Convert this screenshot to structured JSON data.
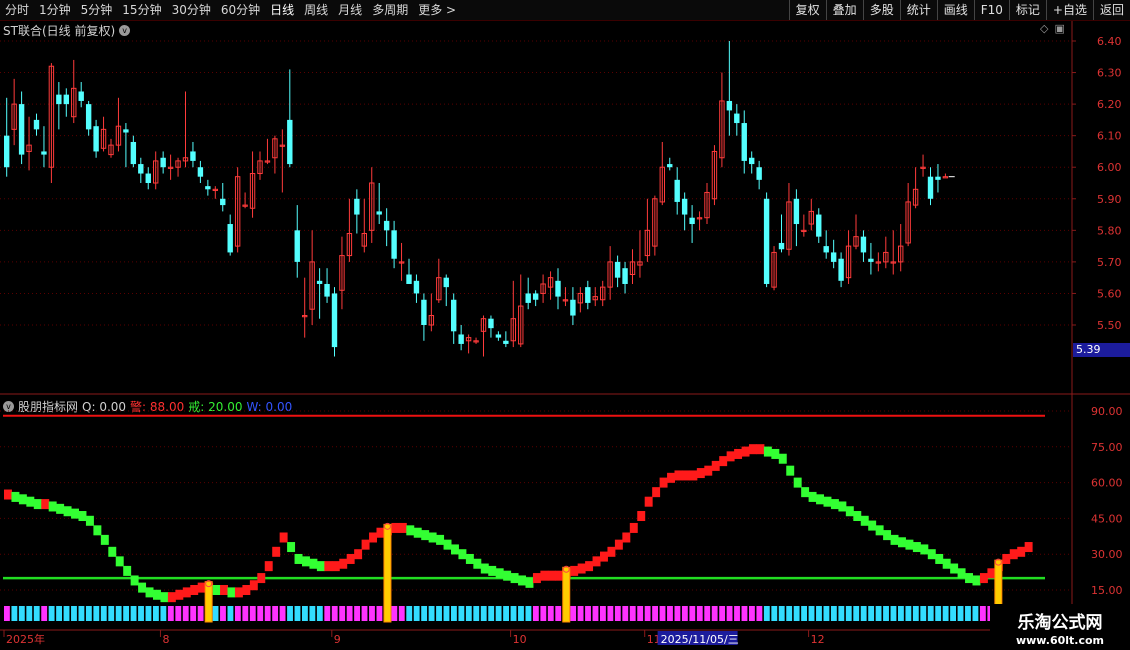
{
  "toolbar": {
    "periods": [
      "分时",
      "1分钟",
      "5分钟",
      "15分钟",
      "30分钟",
      "60分钟",
      "日线",
      "周线",
      "月线",
      "多周期",
      "更多 >"
    ],
    "active": "日线",
    "right_buttons": [
      "复权",
      "叠加",
      "多股",
      "统计",
      "画线",
      "F10",
      "标记",
      "+自选",
      "返回"
    ]
  },
  "title": "ST联合(日线 前复权)",
  "indicator": {
    "name": "股朋指标网",
    "q_label": "Q: 0.00",
    "warn_label": "警: 88.00",
    "jie_label": "戒: 20.00",
    "w_label": "W: 0.00"
  },
  "price_axis": [
    "6.40",
    "6.30",
    "6.20",
    "6.10",
    "6.00",
    "5.90",
    "5.80",
    "5.70",
    "5.60",
    "5.50"
  ],
  "current_price": "5.39",
  "ind_axis": [
    "90.00",
    "75.00",
    "60.00",
    "45.00",
    "30.00",
    "15.00"
  ],
  "date_axis": {
    "labels": [
      {
        "t": "2025年",
        "i": 0
      },
      {
        "t": "8",
        "i": 21
      },
      {
        "t": "9",
        "i": 44
      },
      {
        "t": "10",
        "i": 68
      },
      {
        "t": "11",
        "i": 86
      },
      {
        "t": "12",
        "i": 108
      }
    ],
    "highlight": "2025/11/05/三",
    "highlight_i": 88
  },
  "watermark": {
    "line1": "乐淘公式网",
    "line2": "www.60lt.com"
  },
  "colors": {
    "up": "#ff3b3b",
    "down": "#54ffff",
    "green_line": "#22dd22",
    "red_line": "#ee1111",
    "ind_up": "#ff1a1a",
    "ind_down": "#33ff33",
    "bar_cyan": "#33ddff",
    "bar_magenta": "#ff33ff",
    "signal": "#ffcc00"
  },
  "chart_data": {
    "type": "candlestick",
    "price_ylim": [
      5.4,
      6.45
    ],
    "ind_ylim": [
      10,
      95
    ],
    "warn_level": 88,
    "jie_level": 20,
    "candles": [
      [
        6.1,
        6.0,
        6.22,
        5.97
      ],
      [
        6.12,
        6.2,
        6.28,
        6.07
      ],
      [
        6.2,
        6.04,
        6.24,
        6.01
      ],
      [
        6.05,
        6.07,
        6.16,
        5.99
      ],
      [
        6.15,
        6.12,
        6.17,
        6.1
      ],
      [
        6.05,
        6.04,
        6.13,
        6.0
      ],
      [
        6.0,
        6.32,
        6.33,
        5.95
      ],
      [
        6.23,
        6.2,
        6.27,
        6.12
      ],
      [
        6.23,
        6.2,
        6.25,
        6.16
      ],
      [
        6.16,
        6.25,
        6.34,
        6.14
      ],
      [
        6.24,
        6.21,
        6.27,
        6.19
      ],
      [
        6.2,
        6.12,
        6.21,
        6.1
      ],
      [
        6.13,
        6.05,
        6.15,
        6.03
      ],
      [
        6.06,
        6.12,
        6.16,
        6.05
      ],
      [
        6.04,
        6.07,
        6.09,
        6.03
      ],
      [
        6.07,
        6.13,
        6.22,
        6.05
      ],
      [
        6.12,
        6.11,
        6.14,
        6.0
      ],
      [
        6.08,
        6.01,
        6.1,
        6.0
      ],
      [
        6.01,
        5.98,
        6.03,
        5.95
      ],
      [
        5.98,
        5.95,
        6.0,
        5.93
      ],
      [
        5.95,
        6.02,
        6.05,
        5.93
      ],
      [
        6.03,
        6.0,
        6.05,
        5.98
      ],
      [
        6.0,
        6.0,
        6.04,
        5.96
      ],
      [
        6.0,
        6.02,
        6.03,
        5.97
      ],
      [
        6.02,
        6.03,
        6.24,
        6.0
      ],
      [
        6.05,
        6.02,
        6.08,
        6.0
      ],
      [
        6.0,
        5.97,
        6.02,
        5.95
      ],
      [
        5.94,
        5.93,
        5.96,
        5.91
      ],
      [
        5.93,
        5.93,
        5.94,
        5.9
      ],
      [
        5.9,
        5.88,
        5.95,
        5.86
      ],
      [
        5.82,
        5.73,
        5.85,
        5.72
      ],
      [
        5.75,
        5.97,
        6.0,
        5.73
      ],
      [
        5.88,
        5.88,
        5.92,
        5.87
      ],
      [
        5.87,
        5.98,
        6.05,
        5.84
      ],
      [
        5.98,
        6.02,
        6.05,
        5.96
      ],
      [
        6.02,
        6.02,
        6.09,
        6.01
      ],
      [
        6.03,
        6.09,
        6.1,
        5.98
      ],
      [
        6.07,
        6.07,
        6.12,
        5.92
      ],
      [
        6.15,
        6.01,
        6.31,
        6.0
      ],
      [
        5.8,
        5.7,
        5.88,
        5.65
      ],
      [
        5.53,
        5.53,
        5.65,
        5.46
      ],
      [
        5.55,
        5.7,
        5.8,
        5.5
      ],
      [
        5.64,
        5.63,
        5.68,
        5.52
      ],
      [
        5.63,
        5.59,
        5.68,
        5.57
      ],
      [
        5.6,
        5.43,
        5.62,
        5.4
      ],
      [
        5.61,
        5.72,
        5.78,
        5.55
      ],
      [
        5.72,
        5.79,
        5.9,
        5.7
      ],
      [
        5.9,
        5.85,
        5.93,
        5.79
      ],
      [
        5.75,
        5.79,
        5.9,
        5.73
      ],
      [
        5.8,
        5.95,
        6.0,
        5.76
      ],
      [
        5.86,
        5.85,
        5.95,
        5.82
      ],
      [
        5.83,
        5.8,
        5.87,
        5.75
      ],
      [
        5.8,
        5.71,
        5.83,
        5.68
      ],
      [
        5.7,
        5.7,
        5.76,
        5.64
      ],
      [
        5.66,
        5.63,
        5.71,
        5.63
      ],
      [
        5.64,
        5.6,
        5.66,
        5.57
      ],
      [
        5.58,
        5.5,
        5.6,
        5.45
      ],
      [
        5.5,
        5.53,
        5.6,
        5.48
      ],
      [
        5.58,
        5.65,
        5.71,
        5.57
      ],
      [
        5.65,
        5.62,
        5.66,
        5.56
      ],
      [
        5.58,
        5.48,
        5.6,
        5.44
      ],
      [
        5.47,
        5.44,
        5.5,
        5.42
      ],
      [
        5.45,
        5.46,
        5.47,
        5.41
      ],
      [
        5.45,
        5.45,
        5.46,
        5.44
      ],
      [
        5.48,
        5.52,
        5.53,
        5.4
      ],
      [
        5.52,
        5.49,
        5.53,
        5.46
      ],
      [
        5.47,
        5.46,
        5.48,
        5.45
      ],
      [
        5.45,
        5.44,
        5.48,
        5.43
      ],
      [
        5.45,
        5.52,
        5.64,
        5.43
      ],
      [
        5.44,
        5.56,
        5.66,
        5.43
      ],
      [
        5.6,
        5.57,
        5.65,
        5.55
      ],
      [
        5.6,
        5.58,
        5.61,
        5.56
      ],
      [
        5.6,
        5.63,
        5.66,
        5.57
      ],
      [
        5.62,
        5.65,
        5.67,
        5.58
      ],
      [
        5.64,
        5.59,
        5.68,
        5.55
      ],
      [
        5.58,
        5.58,
        5.62,
        5.56
      ],
      [
        5.58,
        5.53,
        5.62,
        5.5
      ],
      [
        5.57,
        5.6,
        5.62,
        5.54
      ],
      [
        5.62,
        5.57,
        5.64,
        5.55
      ],
      [
        5.58,
        5.59,
        5.62,
        5.56
      ],
      [
        5.58,
        5.62,
        5.64,
        5.56
      ],
      [
        5.62,
        5.7,
        5.75,
        5.58
      ],
      [
        5.7,
        5.65,
        5.72,
        5.62
      ],
      [
        5.68,
        5.63,
        5.7,
        5.6
      ],
      [
        5.66,
        5.7,
        5.74,
        5.63
      ],
      [
        5.69,
        5.7,
        5.8,
        5.65
      ],
      [
        5.72,
        5.8,
        5.9,
        5.7
      ],
      [
        5.75,
        5.9,
        5.91,
        5.72
      ],
      [
        5.89,
        6.0,
        6.08,
        5.88
      ],
      [
        6.01,
        6.0,
        6.03,
        5.99
      ],
      [
        5.96,
        5.89,
        6.0,
        5.85
      ],
      [
        5.9,
        5.85,
        5.92,
        5.8
      ],
      [
        5.84,
        5.82,
        5.88,
        5.76
      ],
      [
        5.84,
        5.84,
        5.86,
        5.8
      ],
      [
        5.84,
        5.92,
        5.95,
        5.82
      ],
      [
        5.9,
        6.05,
        6.07,
        5.88
      ],
      [
        6.03,
        6.21,
        6.3,
        6.0
      ],
      [
        6.21,
        6.18,
        6.4,
        6.1
      ],
      [
        6.17,
        6.14,
        6.2,
        6.1
      ],
      [
        6.14,
        6.02,
        6.18,
        5.98
      ],
      [
        6.03,
        6.01,
        6.05,
        5.98
      ],
      [
        6.0,
        5.96,
        6.02,
        5.93
      ],
      [
        5.9,
        5.63,
        5.92,
        5.62
      ],
      [
        5.62,
        5.73,
        5.75,
        5.61
      ],
      [
        5.76,
        5.74,
        5.85,
        5.73
      ],
      [
        5.74,
        5.89,
        5.95,
        5.72
      ],
      [
        5.9,
        5.82,
        5.93,
        5.75
      ],
      [
        5.8,
        5.8,
        5.85,
        5.78
      ],
      [
        5.82,
        5.86,
        5.9,
        5.8
      ],
      [
        5.85,
        5.78,
        5.87,
        5.76
      ],
      [
        5.75,
        5.73,
        5.8,
        5.71
      ],
      [
        5.73,
        5.7,
        5.77,
        5.68
      ],
      [
        5.71,
        5.64,
        5.73,
        5.62
      ],
      [
        5.65,
        5.75,
        5.8,
        5.63
      ],
      [
        5.75,
        5.78,
        5.85,
        5.74
      ],
      [
        5.78,
        5.73,
        5.8,
        5.7
      ],
      [
        5.71,
        5.7,
        5.76,
        5.66
      ],
      [
        5.7,
        5.7,
        5.73,
        5.67
      ],
      [
        5.7,
        5.73,
        5.78,
        5.68
      ],
      [
        5.7,
        5.7,
        5.8,
        5.66
      ],
      [
        5.7,
        5.75,
        5.82,
        5.67
      ],
      [
        5.76,
        5.89,
        5.95,
        5.75
      ],
      [
        5.88,
        5.93,
        6.0,
        5.87
      ],
      [
        6.0,
        6.0,
        6.04,
        5.97
      ],
      [
        5.97,
        5.9,
        6.0,
        5.88
      ],
      [
        5.97,
        5.96,
        6.01,
        5.92
      ],
      [
        5.97,
        5.97,
        5.98,
        5.97
      ]
    ],
    "indicator": [
      55,
      54,
      53,
      52,
      51,
      51,
      50,
      49,
      48,
      47,
      46,
      44,
      40,
      36,
      31,
      27,
      23,
      19,
      16,
      14,
      13,
      12,
      12,
      13,
      14,
      15,
      16,
      16,
      15,
      15,
      14,
      14,
      15,
      17,
      20,
      25,
      31,
      37,
      33,
      28,
      27,
      26,
      25,
      25,
      25,
      26,
      28,
      30,
      34,
      37,
      39,
      40,
      41,
      41,
      40,
      39,
      38,
      37,
      36,
      34,
      32,
      30,
      28,
      26,
      24,
      23,
      22,
      21,
      20,
      19,
      18,
      20,
      21,
      21,
      21,
      22,
      23,
      24,
      25,
      27,
      29,
      31,
      34,
      37,
      41,
      46,
      52,
      56,
      60,
      62,
      63,
      63,
      63,
      64,
      65,
      67,
      69,
      71,
      72,
      73,
      74,
      74,
      73,
      72,
      70,
      65,
      60,
      56,
      54,
      53,
      52,
      51,
      50,
      48,
      46,
      44,
      42,
      40,
      38,
      36,
      35,
      34,
      33,
      32,
      30,
      28,
      26,
      24,
      22,
      20,
      19,
      20,
      22,
      25,
      28,
      30,
      31,
      33
    ],
    "signals": [
      27,
      51,
      75,
      133
    ]
  }
}
